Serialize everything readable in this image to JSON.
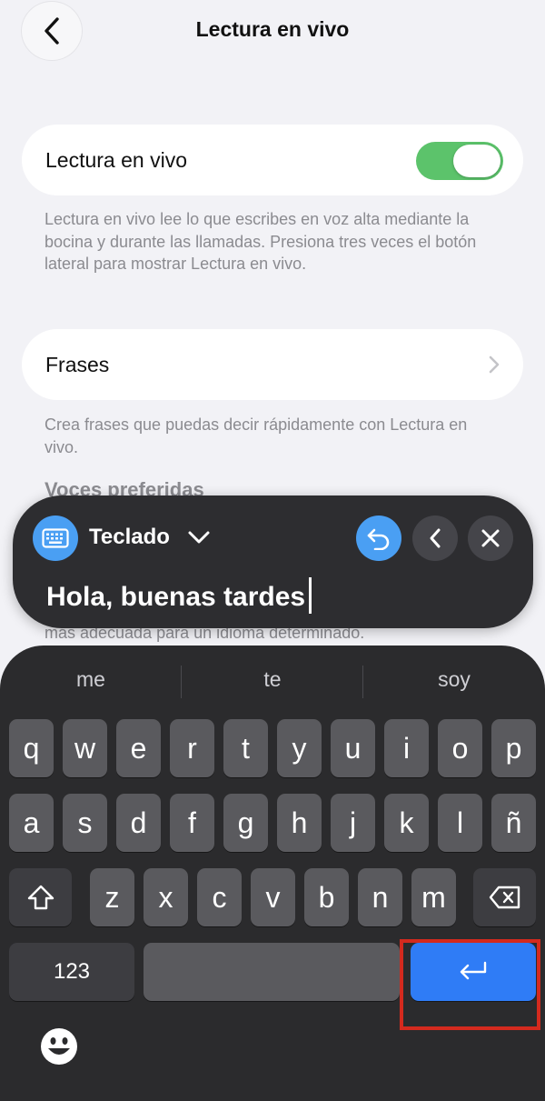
{
  "header": {
    "title": "Lectura en vivo"
  },
  "live_speech_card": {
    "label": "Lectura en vivo",
    "toggle_on": true
  },
  "live_speech_footnote": "Lectura en vivo lee lo que escribes en voz alta mediante la bocina y durante las llamadas. Presiona tres veces el botón lateral para mostrar Lectura en vivo.",
  "phrases_card": {
    "label": "Frases"
  },
  "phrases_footnote": "Crea frases que puedas decir rápidamente con Lectura en vivo.",
  "voices_section_header": "Voces preferidas",
  "voices_footnote_partial": "más adecuada para un idioma determinado.",
  "panel": {
    "source_label": "Teclado",
    "typed_text": "Hola, buenas tardes",
    "icons": [
      "keyboard-icon",
      "chevron-down-icon",
      "undo-icon",
      "chevron-left-icon",
      "close-icon"
    ]
  },
  "keyboard": {
    "suggestions": [
      "me",
      "te",
      "soy"
    ],
    "row1": [
      "q",
      "w",
      "e",
      "r",
      "t",
      "y",
      "u",
      "i",
      "o",
      "p"
    ],
    "row2": [
      "a",
      "s",
      "d",
      "f",
      "g",
      "h",
      "j",
      "k",
      "l",
      "ñ"
    ],
    "row3": [
      "z",
      "x",
      "c",
      "v",
      "b",
      "n",
      "m"
    ],
    "numbers_label": "123"
  },
  "colors": {
    "toggle_on": "#5cc36b",
    "accent_blue": "#4a9ff3",
    "return_key": "#2f7cf6",
    "highlight": "#d42a1e"
  }
}
